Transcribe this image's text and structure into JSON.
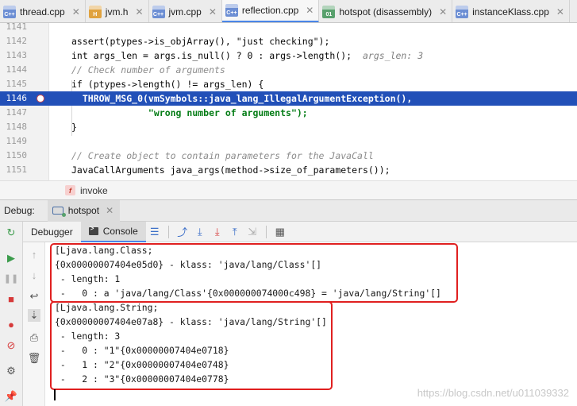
{
  "tabs": [
    {
      "label": "thread.cpp",
      "icon": "cpp-file-icon",
      "active": false
    },
    {
      "label": "jvm.h",
      "icon": "header-file-icon",
      "active": false
    },
    {
      "label": "jvm.cpp",
      "icon": "cpp-file-icon",
      "active": false
    },
    {
      "label": "reflection.cpp",
      "icon": "cpp-file-icon",
      "active": true
    },
    {
      "label": "hotspot (disassembly)",
      "icon": "disassembly-file-icon",
      "active": false
    },
    {
      "label": "instanceKlass.cpp",
      "icon": "cpp-file-icon",
      "active": false
    }
  ],
  "editor": {
    "lines": [
      {
        "num": "1141",
        "text": ""
      },
      {
        "num": "1142",
        "text": "assert(ptypes->is_objArray(), \"just checking\");"
      },
      {
        "num": "1143",
        "text": "int args_len = args.is_null() ? 0 : args->length();",
        "hint": "args_len: 3"
      },
      {
        "num": "1144",
        "text": "// Check number of arguments"
      },
      {
        "num": "1145",
        "text": "if (ptypes->length() != args_len) {"
      },
      {
        "num": "1146",
        "text": "  THROW_MSG_0(vmSymbols::java_lang_IllegalArgumentException(),",
        "highlighted": true,
        "breakpoint": true
      },
      {
        "num": "1147",
        "text": "              \"wrong number of arguments\");"
      },
      {
        "num": "1148",
        "text": "}"
      },
      {
        "num": "1149",
        "text": ""
      },
      {
        "num": "1150",
        "text": "// Create object to contain parameters for the JavaCall"
      },
      {
        "num": "1151",
        "text": "JavaCallArguments java_args(method->size_of_parameters());"
      }
    ]
  },
  "breadcrumb": {
    "badge": "f",
    "label": "invoke"
  },
  "debug": {
    "title": "Debug:",
    "session": "hotspot",
    "subtabs": [
      "Debugger",
      "Console"
    ],
    "active_subtab": "Console"
  },
  "console": {
    "lines": [
      "[Ljava.lang.Class;",
      "{0x00000007404e05d0} - klass: 'java/lang/Class'[]",
      " - length: 1",
      " -   0 : a 'java/lang/Class'{0x000000074000c498} = 'java/lang/String'[]",
      "[Ljava.lang.String;",
      "{0x00000007404e07a8} - klass: 'java/lang/String'[]",
      " - length: 3",
      " -   0 : \"1\"{0x00000007404e0718}",
      " -   1 : \"2\"{0x00000007404e0748}",
      " -   2 : \"3\"{0x00000007404e0778}"
    ]
  },
  "watermark": "https://blog.csdn.net/u011039332",
  "colors": {
    "highlight_line": "#2250b8",
    "annotation_box": "#e02020",
    "active_tab_underline": "#4a86e8"
  }
}
